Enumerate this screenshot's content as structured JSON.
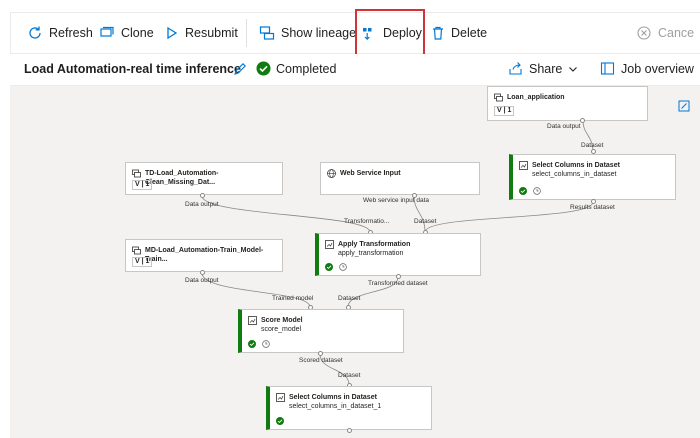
{
  "toolbar": {
    "refresh": "Refresh",
    "clone": "Clone",
    "resubmit": "Resubmit",
    "show_lineage": "Show lineage",
    "deploy": "Deploy",
    "delete": "Delete",
    "cancel": "Cance"
  },
  "titlebar": {
    "title": "Load Automation-real time inference",
    "status": "Completed",
    "share": "Share",
    "job_overview": "Job overview"
  },
  "nodes": {
    "loan": {
      "name": "Loan_application",
      "version": "1",
      "out_label": "Data output"
    },
    "select1": {
      "name": "Select Columns in Dataset",
      "sub": "select_columns_in_dataset",
      "in_label": "Dataset",
      "out_label": "Results dataset"
    },
    "td_clean": {
      "name": "TD-Load_Automation-Clean_Missing_Dat...",
      "version": "1",
      "out_label": "Data output"
    },
    "ws_input": {
      "name": "Web Service Input",
      "out_label": "Web service input data"
    },
    "apply": {
      "name": "Apply Transformation",
      "sub": "apply_transformation",
      "in1_label": "Transformatio...",
      "in2_label": "Dataset",
      "out_label": "Transformed dataset"
    },
    "md_train": {
      "name": "MD-Load_Automation-Train_Model-Train...",
      "version": "1",
      "out_label": "Data output"
    },
    "score": {
      "name": "Score Model",
      "sub": "score_model",
      "in1_label": "Trained model",
      "in2_label": "Dataset",
      "out_label": "Scored dataset"
    },
    "select2": {
      "name": "Select Columns in Dataset",
      "sub": "select_columns_in_dataset_1",
      "in_label": "Dataset"
    }
  },
  "colors": {
    "accent": "#0078d4",
    "success": "#107c10",
    "highlight": "#d13438"
  }
}
